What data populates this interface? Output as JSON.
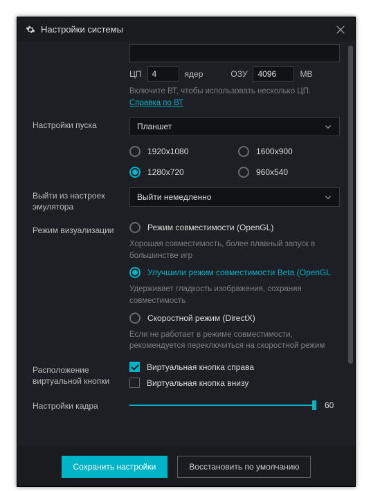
{
  "window": {
    "title": "Настройки системы"
  },
  "perf": {
    "cpu_label": "ЦП",
    "cpu_value": "4",
    "cores_label": "ядер",
    "ram_label": "ОЗУ",
    "ram_value": "4096",
    "ram_unit": "МВ",
    "vt_hint": "Включите ВТ, чтобы использовать несколько ЦП.",
    "vt_link": "Справка по ВТ"
  },
  "launch": {
    "label": "Настройки пуска",
    "select_value": "Планшет",
    "res": [
      {
        "label": "1920x1080",
        "selected": false
      },
      {
        "label": "1600x900",
        "selected": false
      },
      {
        "label": "1280x720",
        "selected": true
      },
      {
        "label": "960x540",
        "selected": false
      }
    ]
  },
  "exit": {
    "label": "Выйти из настроек эмулятора",
    "select_value": "Выйти немедленно"
  },
  "render": {
    "label": "Режим визуализации",
    "opt1_label": "Режим совместимости (OpenGL)",
    "opt1_hint": "Хорошая совместимость, более плавный запуск в большинстве игр",
    "opt2_label": "Улучшили режим совместимости Beta (OpenGL",
    "opt2_hint": "Удерживает гладкость изображения, сохраняя совместимость",
    "opt3_label": "Скоростной режим (DirectX)",
    "opt3_hint": "Если не работает в режиме совместимости, рекомендуется переключиться на скоростной режим",
    "selected": 1
  },
  "vbtn": {
    "label": "Расположение виртуальной кнопки",
    "right_label": "Виртуальная кнопка справа",
    "right_checked": true,
    "bottom_label": "Виртуальная кнопка внизу",
    "bottom_checked": false
  },
  "frame": {
    "label": "Настройки кадра",
    "value": "60"
  },
  "footer": {
    "save": "Сохранить настройки",
    "reset": "Восстановить по умолчанию"
  }
}
